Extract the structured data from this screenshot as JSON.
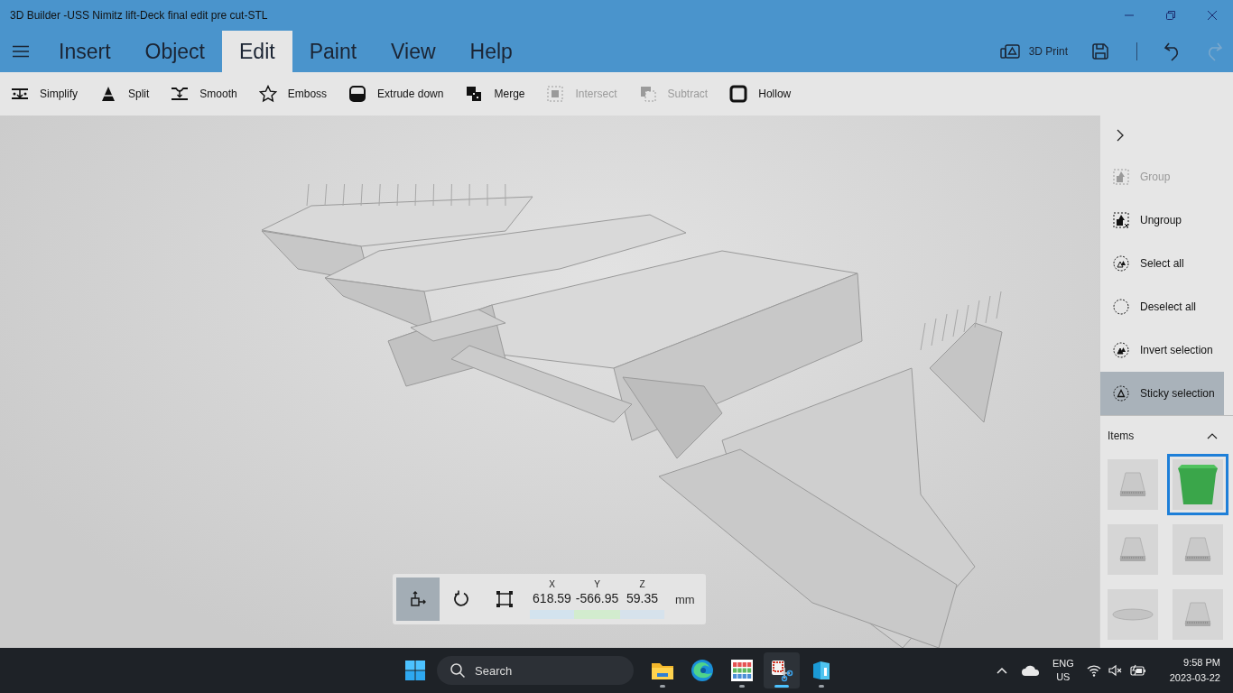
{
  "window": {
    "title": "3D Builder -USS Nimitz lift-Deck final edit pre cut-STL"
  },
  "tabs": [
    {
      "label": "Insert",
      "selected": false
    },
    {
      "label": "Object",
      "selected": false
    },
    {
      "label": "Edit",
      "selected": true
    },
    {
      "label": "Paint",
      "selected": false
    },
    {
      "label": "View",
      "selected": false
    },
    {
      "label": "Help",
      "selected": false
    }
  ],
  "header_actions": {
    "print_label": "3D Print",
    "redo_disabled": true
  },
  "toolbar": [
    {
      "label": "Simplify",
      "kind": "simplify",
      "disabled": false
    },
    {
      "label": "Split",
      "kind": "split",
      "disabled": false
    },
    {
      "label": "Smooth",
      "kind": "smooth",
      "disabled": false
    },
    {
      "label": "Emboss",
      "kind": "emboss",
      "disabled": false
    },
    {
      "label": "Extrude down",
      "kind": "extrude",
      "disabled": false
    },
    {
      "label": "Merge",
      "kind": "merge",
      "disabled": false
    },
    {
      "label": "Intersect",
      "kind": "intersect",
      "disabled": true
    },
    {
      "label": "Subtract",
      "kind": "subtract",
      "disabled": true
    },
    {
      "label": "Hollow",
      "kind": "hollow",
      "disabled": false
    }
  ],
  "side_panel": {
    "actions": [
      {
        "label": "Group",
        "kind": "group",
        "disabled": true,
        "selected": false
      },
      {
        "label": "Ungroup",
        "kind": "ungroup",
        "disabled": false,
        "selected": false
      },
      {
        "label": "Select all",
        "kind": "select",
        "disabled": false,
        "selected": false
      },
      {
        "label": "Deselect all",
        "kind": "deselect",
        "disabled": false,
        "selected": false
      },
      {
        "label": "Invert selection",
        "kind": "invert",
        "disabled": false,
        "selected": false
      },
      {
        "label": "Sticky selection",
        "kind": "sticky",
        "disabled": false,
        "selected": true
      }
    ],
    "items_heading": "Items",
    "items_expanded": true,
    "items": [
      {
        "kind": "model",
        "selected": false
      },
      {
        "kind": "cube",
        "selected": true
      },
      {
        "kind": "model",
        "selected": false
      },
      {
        "kind": "model",
        "selected": false
      },
      {
        "kind": "disc",
        "selected": false
      },
      {
        "kind": "model",
        "selected": false
      }
    ]
  },
  "transform": {
    "tools": [
      {
        "kind": "move",
        "selected": true
      },
      {
        "kind": "rotate",
        "selected": false
      },
      {
        "kind": "scale",
        "selected": false
      }
    ],
    "axes": [
      {
        "label": "X",
        "value": "618.59",
        "color": "#d3e3ee"
      },
      {
        "label": "Y",
        "value": "-566.95",
        "color": "#d2ecce"
      },
      {
        "label": "Z",
        "value": "59.35",
        "color": "#d6e2ec"
      }
    ],
    "unit": "mm"
  },
  "taskbar": {
    "search_label": "Search",
    "apps": [
      {
        "kind": "folder",
        "running": true,
        "active": false
      },
      {
        "kind": "browser",
        "running": false,
        "active": false
      },
      {
        "kind": "grid",
        "running": true,
        "active": false
      },
      {
        "kind": "snipping",
        "running": true,
        "active": true
      },
      {
        "kind": "builder",
        "running": true,
        "active": false
      }
    ],
    "language": "ENG",
    "region": "US",
    "time": "9:58 PM",
    "date": "2023-03-22"
  }
}
